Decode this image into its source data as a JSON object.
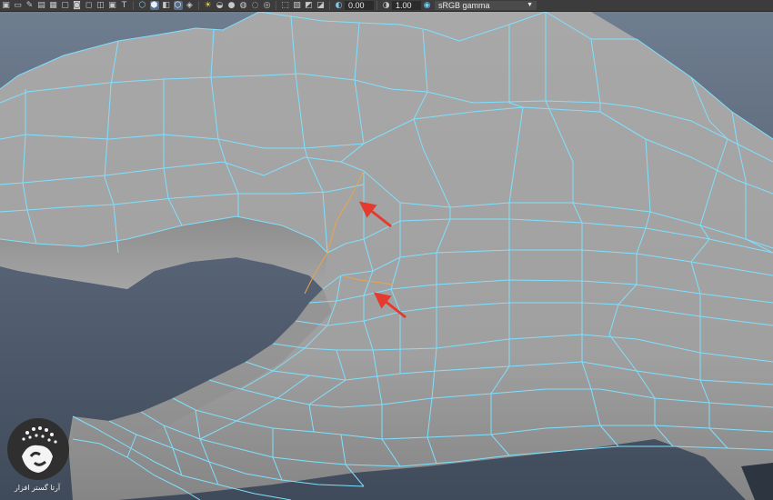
{
  "toolbar": {
    "icons": [
      {
        "name": "select-camera-icon",
        "glyph": "▣"
      },
      {
        "name": "lock-camera-icon",
        "glyph": "▭"
      },
      {
        "name": "bookmarks-icon",
        "glyph": "✎"
      },
      {
        "name": "image-plane-icon",
        "glyph": "▤"
      },
      {
        "name": "grid-icon",
        "glyph": "▦"
      },
      {
        "name": "film-gate-icon",
        "glyph": "▢"
      },
      {
        "name": "resolution-gate-icon",
        "glyph": "◙"
      },
      {
        "name": "gate-mask-icon",
        "glyph": "◻"
      },
      {
        "name": "field-chart-icon",
        "glyph": "◫"
      },
      {
        "name": "safe-action-icon",
        "glyph": "▣"
      },
      {
        "name": "safe-title-icon",
        "glyph": "T"
      },
      {
        "name": "wireframe-icon",
        "glyph": "⬡"
      },
      {
        "name": "smooth-shade-icon",
        "glyph": "⬢"
      },
      {
        "name": "default-material-icon",
        "glyph": "◧"
      },
      {
        "name": "wireframe-on-shaded-icon",
        "glyph": "⬡"
      },
      {
        "name": "textured-icon",
        "glyph": "◈"
      },
      {
        "name": "lights-icon",
        "glyph": "☀"
      },
      {
        "name": "shadows-icon",
        "glyph": "◒"
      },
      {
        "name": "ambient-occlusion-icon",
        "glyph": "●"
      },
      {
        "name": "motion-blur-icon",
        "glyph": "◍"
      },
      {
        "name": "anti-aliasing-icon",
        "glyph": "◌"
      },
      {
        "name": "depth-of-field-icon",
        "glyph": "◎"
      },
      {
        "name": "isolate-select-icon",
        "glyph": "⬚"
      },
      {
        "name": "xray-icon",
        "glyph": "▧"
      },
      {
        "name": "xray-joints-icon",
        "glyph": "◩"
      },
      {
        "name": "xray-components-icon",
        "glyph": "◪"
      },
      {
        "name": "exposure-icon",
        "glyph": "◐"
      },
      {
        "name": "gamma-icon",
        "glyph": "◑"
      },
      {
        "name": "color-management-icon",
        "glyph": "◉"
      }
    ],
    "exposure_value": "0.00",
    "gamma_value": "1.00",
    "color_space": "sRGB gamma",
    "dropdown_glyph": "▼"
  },
  "viewport": {
    "background_top": "#6f7d90",
    "background_bottom": "#3f4a5a",
    "mesh_fill": "#a2a2a2",
    "mesh_shadow": "#7c7c7c",
    "wire_color": "#7fe0ff",
    "selected_edge_color": "#e8a44a",
    "arrow_color": "#e63a2e"
  },
  "watermark": {
    "caption": "آرتا گستر افزار"
  }
}
